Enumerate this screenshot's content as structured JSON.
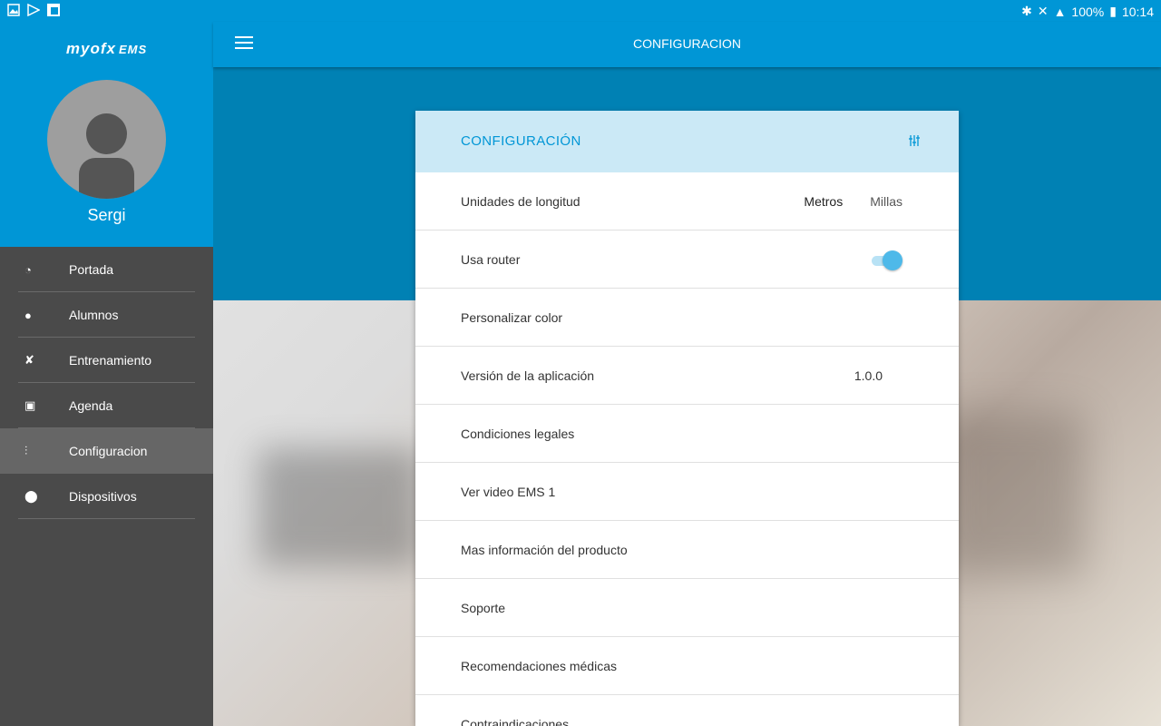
{
  "statusbar": {
    "battery": "100%",
    "time": "10:14"
  },
  "sidebar": {
    "logo": "myofx",
    "logo_suffix": "EMS",
    "username": "Sergi",
    "items": [
      {
        "label": "Portada",
        "icon": "dashboard-icon"
      },
      {
        "label": "Alumnos",
        "icon": "person-icon"
      },
      {
        "label": "Entrenamiento",
        "icon": "training-icon"
      },
      {
        "label": "Agenda",
        "icon": "calendar-icon"
      },
      {
        "label": "Configuracion",
        "icon": "sliders-icon",
        "active": true
      },
      {
        "label": "Dispositivos",
        "icon": "devices-icon"
      }
    ]
  },
  "appbar": {
    "title": "CONFIGURACION"
  },
  "card": {
    "title": "CONFIGURACIÓN",
    "rows": {
      "units_label": "Unidades de longitud",
      "units_option_1": "Metros",
      "units_option_2": "Millas",
      "router_label": "Usa router",
      "router_enabled": true,
      "color_label": "Personalizar color",
      "version_label": "Versión de la aplicación",
      "version_value": "1.0.0",
      "legal_label": "Condiciones legales",
      "video_label": "Ver video EMS 1",
      "info_label": "Mas información del producto",
      "support_label": "Soporte",
      "medical_label": "Recomendaciones médicas",
      "contra_label": "Contraindicaciones"
    }
  },
  "colors": {
    "primary": "#0096d6",
    "primary_dark": "#0081b4",
    "card_header": "#cbe9f6",
    "sidebar": "#4a4a4a"
  }
}
